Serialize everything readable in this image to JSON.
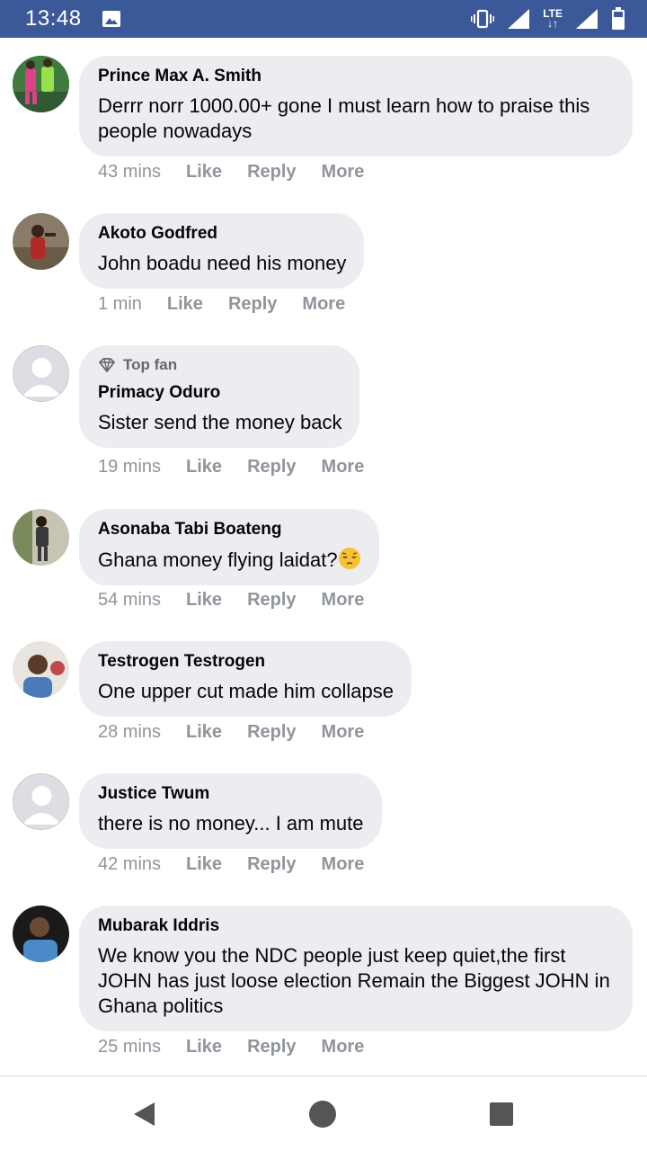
{
  "status_bar": {
    "time": "13:48",
    "lte_top": "LTE",
    "lte_bottom": "↓↑",
    "icons": [
      "gallery-icon",
      "vibrate-icon",
      "signal-icon",
      "signal-icon",
      "battery-icon"
    ]
  },
  "colors": {
    "status_bar": "#3b5998",
    "bubble": "#ebedf0",
    "meta_text": "#90949c",
    "divider": "#dadde1"
  },
  "comments": [
    {
      "author": "Prince Max A. Smith",
      "text": "Derrr norr 1000.00+ gone I must learn how to praise this people nowadays",
      "time": "43 mins",
      "like": "Like",
      "reply": "Reply",
      "more": "More"
    },
    {
      "author": "Akoto Godfred",
      "text": "John boadu need his money",
      "time": "1 min",
      "like": "Like",
      "reply": "Reply",
      "more": "More"
    },
    {
      "badge": "Top fan",
      "author": "Primacy Oduro",
      "text": "Sister send the money back",
      "time": "19 mins",
      "like": "Like",
      "reply": "Reply",
      "more": "More"
    },
    {
      "author": "Asonaba Tabi Boateng",
      "text": "Ghana money flying laidat?",
      "time": "54 mins",
      "like": "Like",
      "reply": "Reply",
      "more": "More"
    },
    {
      "author": "Testrogen Testrogen",
      "text": "One upper cut made him collapse",
      "time": "28 mins",
      "like": "Like",
      "reply": "Reply",
      "more": "More"
    },
    {
      "author": "Justice Twum",
      "text": "there is no money... I am mute",
      "time": "42 mins",
      "like": "Like",
      "reply": "Reply",
      "more": "More"
    },
    {
      "author": "Mubarak Iddris",
      "text": "We know you the NDC people just keep quiet,the first JOHN has just loose election Remain the Biggest JOHN in Ghana politics",
      "time": "25 mins",
      "like": "Like",
      "reply": "Reply",
      "more": "More"
    }
  ],
  "nav_bar": {
    "icons": [
      "back-icon",
      "home-icon",
      "recents-icon"
    ]
  }
}
